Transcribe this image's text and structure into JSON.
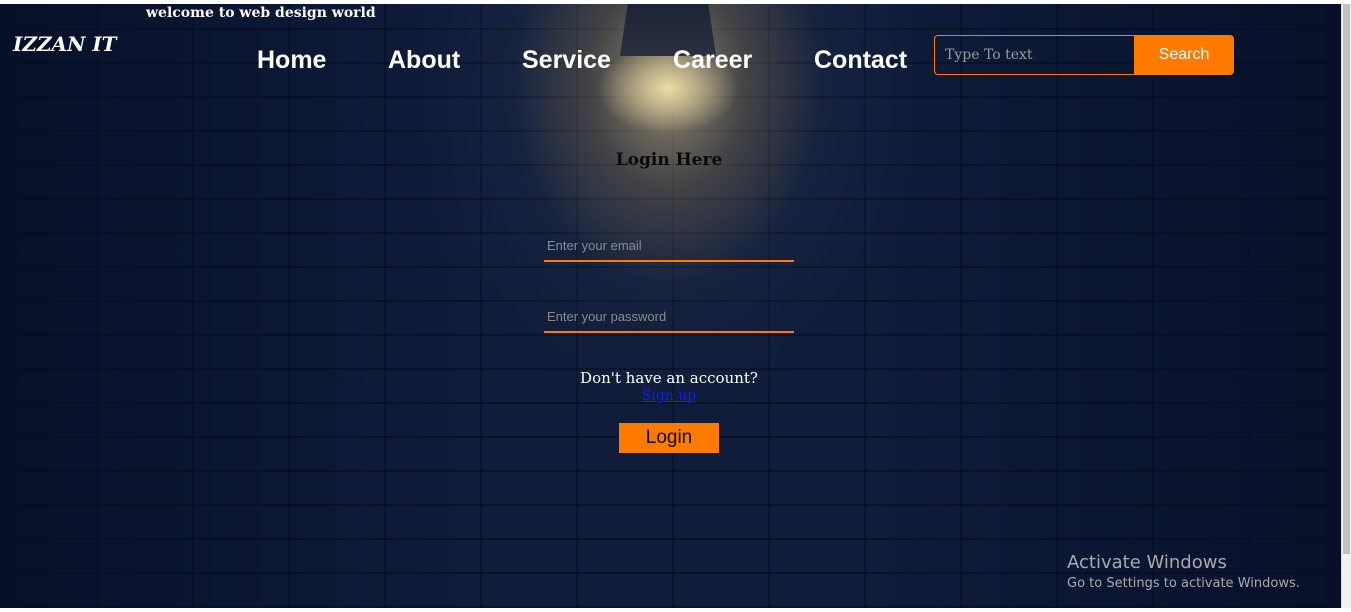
{
  "header": {
    "welcome_text": "welcome to web design world",
    "logo_text": "IZZAN IT"
  },
  "nav": {
    "items": [
      {
        "label": "Home"
      },
      {
        "label": "About"
      },
      {
        "label": "Service"
      },
      {
        "label": "Career"
      },
      {
        "label": "Contact"
      }
    ]
  },
  "search": {
    "placeholder": "Type To text",
    "button_label": "Search"
  },
  "login_form": {
    "title": "Login Here",
    "email_placeholder": "Enter your email",
    "password_placeholder": "Enter your password",
    "account_prompt": "Don't have an account?",
    "signup_link": "Sign up",
    "login_button": "Login"
  },
  "watermark": {
    "title": "Activate Windows",
    "subtitle": "Go to Settings to activate Windows."
  },
  "colors": {
    "accent": "#ff7a00",
    "background": "#0f1c3a",
    "link": "#1a1aff"
  }
}
